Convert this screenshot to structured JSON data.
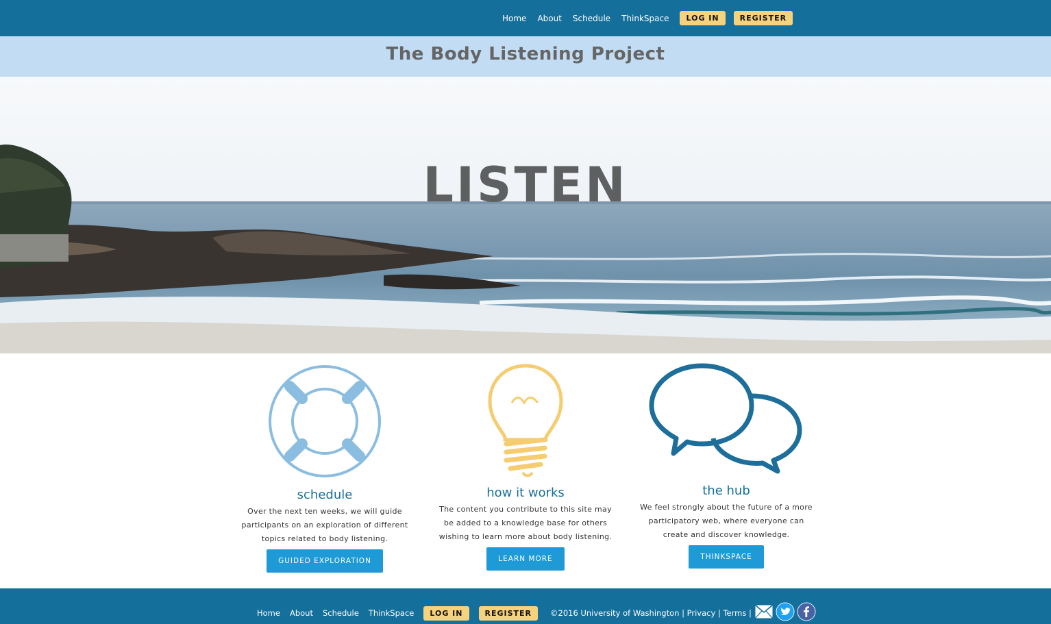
{
  "nav": {
    "home": "Home",
    "about": "About",
    "schedule": "Schedule",
    "thinkspace": "ThinkSpace",
    "login": "LOG IN",
    "register": "REGISTER"
  },
  "site_title": "The Body Listening Project",
  "hero": {
    "word": "LISTEN"
  },
  "features": [
    {
      "icon": "life-ring-icon",
      "title": "schedule",
      "lines": [
        "Over the next ten weeks, we will guide",
        "participants on an exploration of different",
        "topics related to body listening."
      ],
      "button": "GUIDED EXPLORATION"
    },
    {
      "icon": "lightbulb-icon",
      "title": "how it works",
      "lines": [
        "The content you contribute to this site may",
        "be added to a knowledge base for others",
        "wishing to learn more about body listening."
      ],
      "button": "LEARN MORE"
    },
    {
      "icon": "speech-bubbles-icon",
      "title": "the hub",
      "lines": [
        "We feel strongly about the future of a more",
        "participatory web, where everyone can",
        "create and discover knowledge."
      ],
      "button": "THINKSPACE"
    }
  ],
  "footer": {
    "home": "Home",
    "about": "About",
    "schedule": "Schedule",
    "thinkspace": "ThinkSpace",
    "login": "LOG IN",
    "register": "REGISTER",
    "copyright": "©2016 University of Washington",
    "sep1": "|",
    "privacy": "Privacy",
    "sep2": "|",
    "terms": "Terms",
    "sep3": "|",
    "social": [
      "mail-icon",
      "twitter-icon",
      "facebook-icon"
    ]
  },
  "colors": {
    "header_bg": "#146f9b",
    "title_band_bg": "#c1dcf3",
    "accent_yellow": "#f7d27d",
    "button_blue": "#1e9bd7",
    "heading_blue": "#146f9b",
    "icon_light_blue": "#8bbde0",
    "icon_yellow": "#f5cc70",
    "icon_dark_blue": "#1d6e9a"
  }
}
